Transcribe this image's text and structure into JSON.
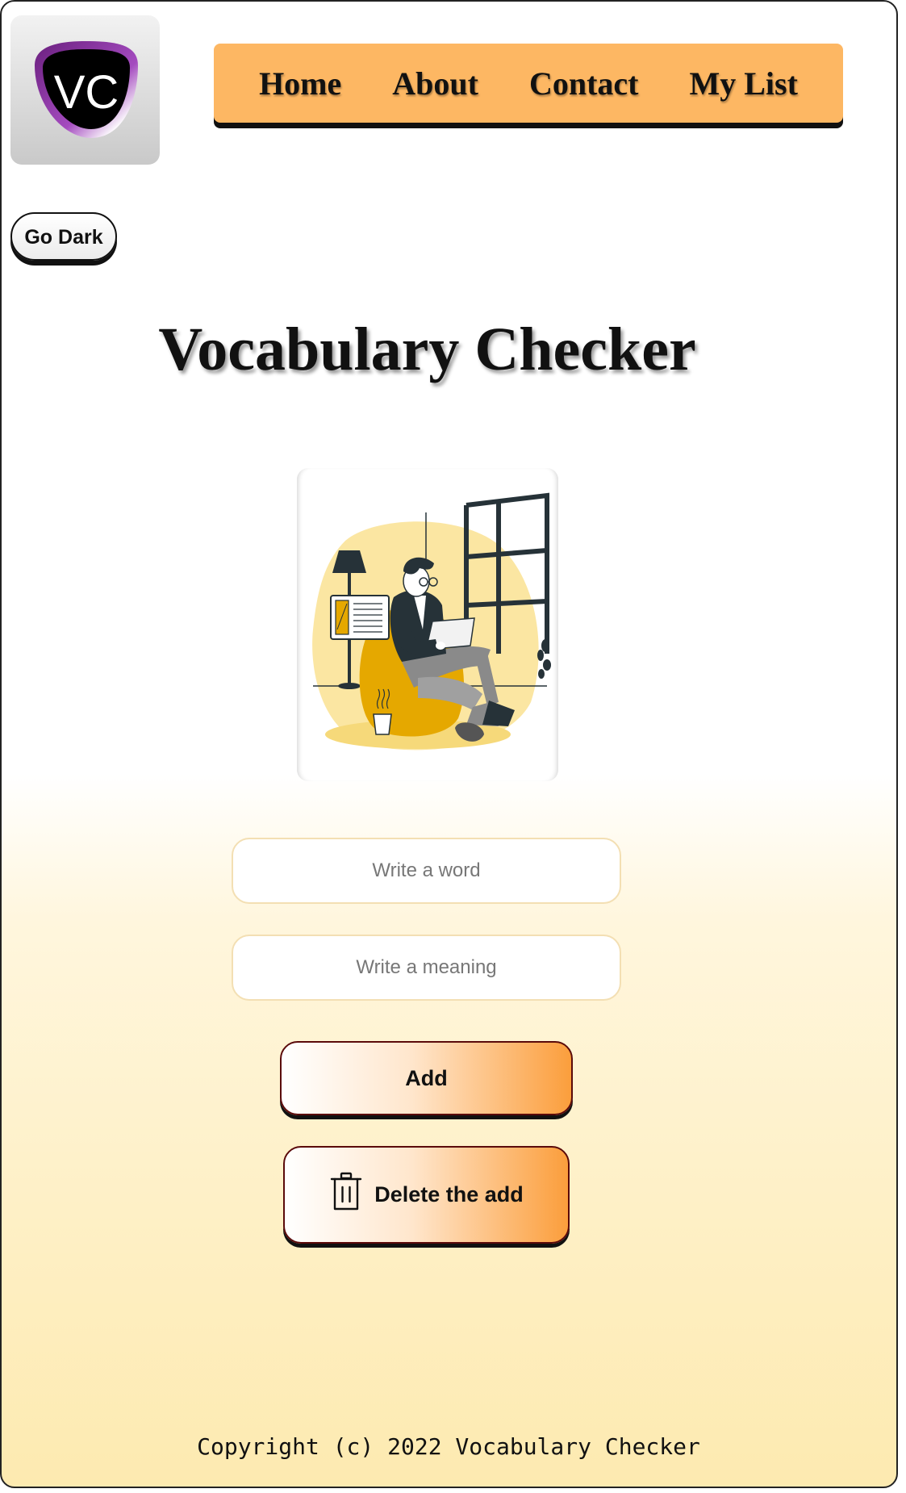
{
  "logo": {
    "text": "VC"
  },
  "nav": {
    "items": [
      {
        "label": "Home"
      },
      {
        "label": "About"
      },
      {
        "label": "Contact"
      },
      {
        "label": "My List"
      }
    ]
  },
  "theme_toggle": {
    "label": "Go Dark"
  },
  "main": {
    "title": "Vocabulary Checker",
    "illustration": "person-reading-on-chair-illustration"
  },
  "form": {
    "word_placeholder": "Write a word",
    "word_value": "",
    "meaning_placeholder": "Write a meaning",
    "meaning_value": "",
    "add_label": "Add",
    "delete_label": "Delete the add",
    "delete_icon": "trash-icon"
  },
  "footer": {
    "copyright": "Copyright (c) 2022 Vocabulary Checker"
  },
  "colors": {
    "nav_bg": "#fdb763",
    "button_accent": "#fb9e3c",
    "button_border": "#5a0a0a",
    "logo_ring": "#9b3fb0",
    "illustration_yellow": "#fbe6a2",
    "illustration_mustard": "#e5a800"
  }
}
